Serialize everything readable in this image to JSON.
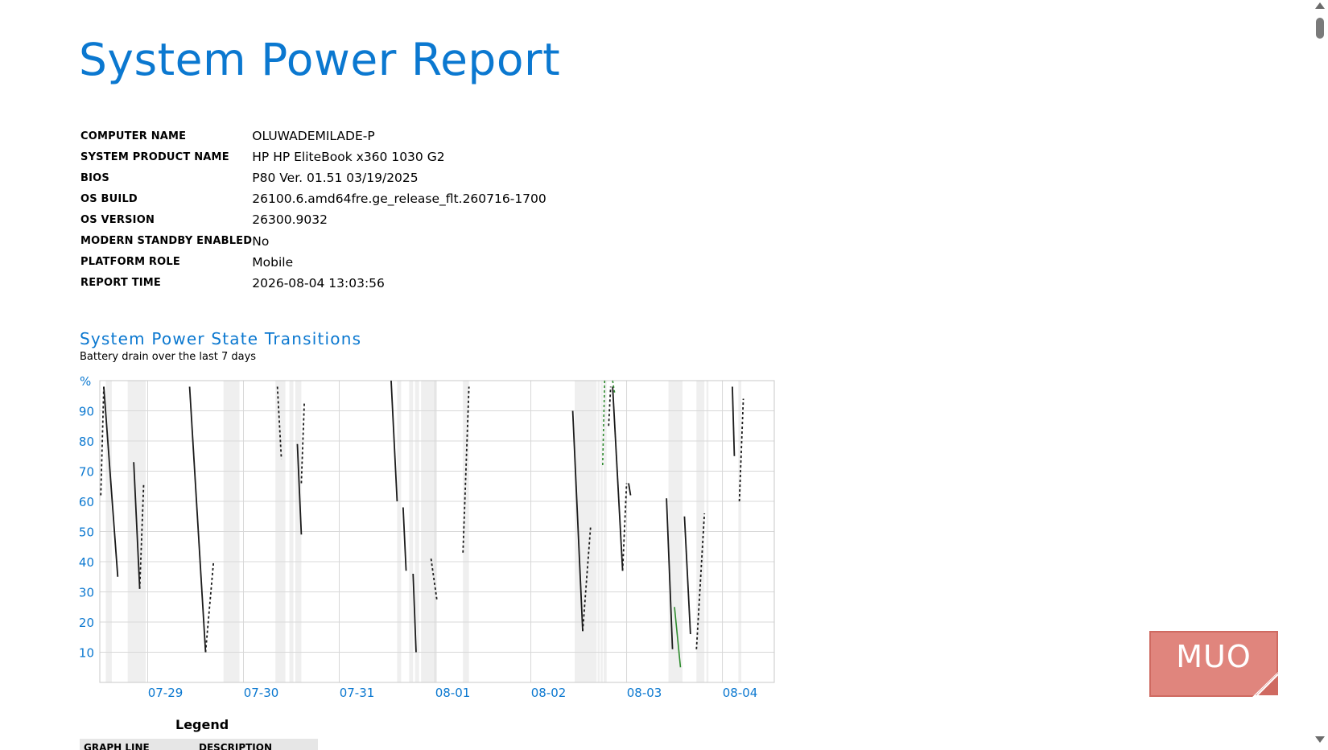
{
  "page": {
    "title": "System Power Report"
  },
  "system_info": [
    {
      "label": "COMPUTER NAME",
      "value": "OLUWADEMILADE-P"
    },
    {
      "label": "SYSTEM PRODUCT NAME",
      "value": "HP HP EliteBook x360 1030 G2"
    },
    {
      "label": "BIOS",
      "value": "P80 Ver. 01.51 03/19/2025"
    },
    {
      "label": "OS BUILD",
      "value": "26100.6.amd64fre.ge_release_flt.260716-1700"
    },
    {
      "label": "OS VERSION",
      "value": "26300.9032"
    },
    {
      "label": "MODERN STANDBY ENABLED",
      "value": "No"
    },
    {
      "label": "PLATFORM ROLE",
      "value": "Mobile"
    },
    {
      "label": "REPORT TIME",
      "value": "2026-08-04 13:03:56"
    }
  ],
  "section": {
    "title": "System Power State Transitions",
    "subtitle": "Battery drain over the last 7 days"
  },
  "legend": {
    "title": "Legend",
    "col_graph_line": "GRAPH LINE",
    "col_description": "DESCRIPTION"
  },
  "watermark": {
    "text": "MUO"
  },
  "colors": {
    "accent": "#0b78d0",
    "battery": "#1a1a1a",
    "charging": "#2e8b2e",
    "shade": "#efefef",
    "grid": "#d8d8d8"
  },
  "icons": {
    "scroll_up": "triangle-up-icon",
    "scroll_down": "triangle-down-icon"
  },
  "chart_data": {
    "type": "line",
    "title": "",
    "ylabel": "%",
    "xlabel": "",
    "ylim": [
      0,
      100
    ],
    "xlim": [
      "2026-07-28 12:00",
      "2026-08-04 13:00"
    ],
    "yticks": [
      "10",
      "20",
      "30",
      "40",
      "50",
      "60",
      "70",
      "80",
      "90"
    ],
    "xticks": [
      "07-29",
      "07-30",
      "07-31",
      "08-01",
      "08-02",
      "08-03",
      "08-04"
    ],
    "xtick_dates": [
      "2026-07-29 00:00",
      "2026-07-30 00:00",
      "2026-07-31 00:00",
      "2026-08-01 00:00",
      "2026-08-02 00:00",
      "2026-08-03 00:00",
      "2026-08-04 00:00"
    ],
    "grid": true,
    "standby_periods": [
      [
        "2026-07-28 13:30",
        "2026-07-28 15:00"
      ],
      [
        "2026-07-28 19:00",
        "2026-07-28 23:30"
      ],
      [
        "2026-07-29 19:00",
        "2026-07-29 23:00"
      ],
      [
        "2026-07-30 08:00",
        "2026-07-30 10:30"
      ],
      [
        "2026-07-30 11:30",
        "2026-07-30 12:30"
      ],
      [
        "2026-07-30 13:00",
        "2026-07-30 14:30"
      ],
      [
        "2026-07-31 14:30",
        "2026-07-31 15:30"
      ],
      [
        "2026-07-31 17:30",
        "2026-07-31 18:30"
      ],
      [
        "2026-07-31 19:00",
        "2026-07-31 20:00"
      ],
      [
        "2026-07-31 20:30",
        "2026-08-01 00:30"
      ],
      [
        "2026-08-01 07:00",
        "2026-08-01 08:30"
      ],
      [
        "2026-08-02 11:00",
        "2026-08-02 16:30"
      ],
      [
        "2026-08-02 16:45",
        "2026-08-02 17:15"
      ],
      [
        "2026-08-02 17:30",
        "2026-08-02 18:00"
      ],
      [
        "2026-08-02 18:15",
        "2026-08-02 19:00"
      ],
      [
        "2026-08-03 10:30",
        "2026-08-03 14:00"
      ],
      [
        "2026-08-03 17:30",
        "2026-08-03 19:30"
      ],
      [
        "2026-08-03 20:00",
        "2026-08-03 20:30"
      ],
      [
        "2026-08-04 04:00",
        "2026-08-04 04:45"
      ]
    ],
    "series": [
      {
        "type": "discharge",
        "segments": [
          [
            [
              "2026-07-28 13:00",
              98
            ],
            [
              "2026-07-28 16:30",
              35
            ]
          ],
          [
            [
              "2026-07-28 20:30",
              73
            ],
            [
              "2026-07-28 22:00",
              31
            ]
          ],
          [
            [
              "2026-07-29 10:30",
              98
            ],
            [
              "2026-07-29 14:30",
              10
            ]
          ],
          [
            [
              "2026-07-30 13:30",
              79
            ],
            [
              "2026-07-30 14:30",
              49
            ]
          ],
          [
            [
              "2026-07-31 13:00",
              100
            ],
            [
              "2026-07-31 14:30",
              60
            ]
          ],
          [
            [
              "2026-07-31 16:00",
              58
            ],
            [
              "2026-07-31 16:45",
              37
            ]
          ],
          [
            [
              "2026-07-31 18:30",
              36
            ],
            [
              "2026-07-31 19:15",
              10
            ]
          ],
          [
            [
              "2026-08-02 10:30",
              90
            ],
            [
              "2026-08-02 13:00",
              17
            ]
          ],
          [
            [
              "2026-08-02 20:30",
              98
            ],
            [
              "2026-08-02 23:00",
              37
            ]
          ],
          [
            [
              "2026-08-03 00:30",
              66
            ],
            [
              "2026-08-03 01:00",
              62
            ]
          ],
          [
            [
              "2026-08-03 10:00",
              61
            ],
            [
              "2026-08-03 11:30",
              11
            ]
          ],
          [
            [
              "2026-08-03 14:30",
              55
            ],
            [
              "2026-08-03 16:00",
              16
            ]
          ],
          [
            [
              "2026-08-04 02:30",
              98
            ],
            [
              "2026-08-04 03:00",
              75
            ]
          ]
        ]
      },
      {
        "type": "charging_dotted",
        "segments": [
          [
            [
              "2026-07-28 12:15",
              62
            ],
            [
              "2026-07-28 13:00",
              98
            ]
          ],
          [
            [
              "2026-07-28 22:00",
              31
            ],
            [
              "2026-07-28 23:00",
              66
            ]
          ],
          [
            [
              "2026-07-29 14:30",
              10
            ],
            [
              "2026-07-29 16:30",
              40
            ]
          ],
          [
            [
              "2026-07-30 08:30",
              98
            ],
            [
              "2026-07-30 09:30",
              74
            ]
          ],
          [
            [
              "2026-07-30 14:30",
              66
            ],
            [
              "2026-07-30 15:15",
              93
            ]
          ],
          [
            [
              "2026-07-31 23:00",
              41
            ],
            [
              "2026-08-01 00:30",
              27
            ]
          ],
          [
            [
              "2026-08-01 07:00",
              43
            ],
            [
              "2026-08-01 08:30",
              98
            ]
          ],
          [
            [
              "2026-08-02 13:00",
              17
            ],
            [
              "2026-08-02 15:00",
              52
            ]
          ],
          [
            [
              "2026-08-02 19:30",
              85
            ],
            [
              "2026-08-02 20:00",
              98
            ]
          ],
          [
            [
              "2026-08-02 23:00",
              37
            ],
            [
              "2026-08-03 00:00",
              66
            ]
          ],
          [
            [
              "2026-08-03 17:30",
              11
            ],
            [
              "2026-08-03 19:30",
              56
            ]
          ],
          [
            [
              "2026-08-04 04:15",
              60
            ],
            [
              "2026-08-04 05:15",
              94
            ]
          ]
        ]
      },
      {
        "type": "charging",
        "segments": [
          [
            [
              "2026-08-02 18:00",
              72
            ],
            [
              "2026-08-02 18:30",
              100
            ]
          ],
          [
            [
              "2026-08-02 20:30",
              100
            ],
            [
              "2026-08-02 21:00",
              96
            ]
          ]
        ]
      },
      {
        "type": "battery_drain_green",
        "segments": [
          [
            [
              "2026-08-03 12:00",
              25
            ],
            [
              "2026-08-03 13:30",
              5
            ]
          ]
        ]
      }
    ]
  }
}
